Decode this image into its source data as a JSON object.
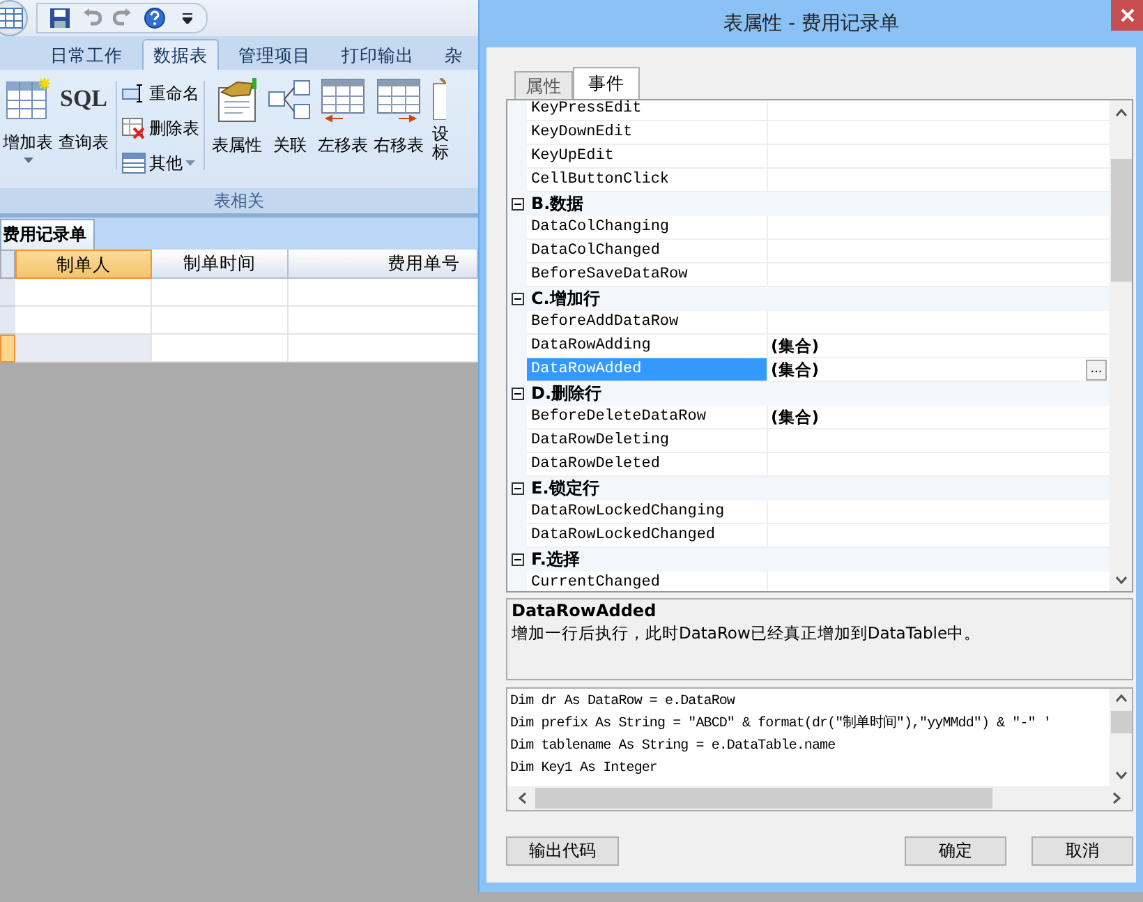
{
  "app": {
    "quick_access": [
      {
        "kind": "save"
      },
      {
        "kind": "undo"
      },
      {
        "kind": "redo"
      },
      {
        "kind": "help"
      },
      {
        "kind": "more"
      }
    ],
    "tabs": [
      {
        "label": "日常工作",
        "selected": false
      },
      {
        "label": "数据表",
        "selected": true
      },
      {
        "label": "管理项目",
        "selected": false
      },
      {
        "label": "打印输出",
        "selected": false
      },
      {
        "label": "杂",
        "selected": false
      }
    ],
    "ribbon": {
      "group": "表相关",
      "large_left": [
        {
          "kind": "add-table",
          "label": "增加表",
          "dropdown": true
        },
        {
          "kind": "sql",
          "icon_text": "SQL",
          "label": "查询表"
        }
      ],
      "small": [
        {
          "kind": "rename",
          "label": "重命名"
        },
        {
          "kind": "delete",
          "label": "删除表"
        },
        {
          "kind": "other",
          "label": "其他",
          "dropdown": true
        }
      ],
      "large_right": [
        {
          "kind": "props",
          "label": "表属性"
        },
        {
          "kind": "relate",
          "label": "关联"
        },
        {
          "kind": "move-left",
          "label": "左移表"
        },
        {
          "kind": "move-right",
          "label": "右移表"
        },
        {
          "kind": "cut",
          "label": "设标"
        }
      ]
    },
    "sheet_tab": "费用记录单",
    "table": {
      "columns": [
        {
          "label": "制单人",
          "selected": true
        },
        {
          "label": "制单时间",
          "selected": false
        },
        {
          "label": "费用单号",
          "selected": false
        }
      ],
      "rows": [
        {
          "selected": false
        },
        {
          "selected": false
        },
        {
          "selected": true
        }
      ]
    }
  },
  "dialog": {
    "title": "表属性 - 费用记录单",
    "tabs": [
      {
        "label": "属性",
        "selected": false
      },
      {
        "label": "事件",
        "selected": true
      }
    ],
    "sections": [
      {
        "items": [
          {
            "name": "KeyPressEdit",
            "selected": false
          },
          {
            "name": "KeyDownEdit",
            "selected": false
          },
          {
            "name": "KeyUpEdit",
            "selected": false
          },
          {
            "name": "CellButtonClick",
            "selected": false
          }
        ]
      },
      {
        "title": "B.数据",
        "expanded": true,
        "items": [
          {
            "name": "DataColChanging",
            "selected": false
          },
          {
            "name": "DataColChanged",
            "selected": false
          },
          {
            "name": "BeforeSaveDataRow",
            "selected": false
          }
        ]
      },
      {
        "title": "C.增加行",
        "expanded": true,
        "items": [
          {
            "name": "BeforeAddDataRow",
            "selected": false
          },
          {
            "name": "DataRowAdding",
            "value": "(集合)",
            "selected": false
          },
          {
            "name": "DataRowAdded",
            "value": "(集合)",
            "button": "...",
            "selected": true
          }
        ]
      },
      {
        "title": "D.删除行",
        "expanded": true,
        "items": [
          {
            "name": "BeforeDeleteDataRow",
            "value": "(集合)",
            "selected": false
          },
          {
            "name": "DataRowDeleting",
            "selected": false
          },
          {
            "name": "DataRowDeleted",
            "selected": false
          }
        ]
      },
      {
        "title": "E.锁定行",
        "expanded": true,
        "items": [
          {
            "name": "DataRowLockedChanging",
            "selected": false
          },
          {
            "name": "DataRowLockedChanged",
            "selected": false
          }
        ]
      },
      {
        "title": "F.选择",
        "expanded": true,
        "items": [
          {
            "name": "CurrentChanged",
            "selected": false
          }
        ]
      }
    ],
    "description": {
      "title": "DataRowAdded",
      "text": "增加一行后执行，此时DataRow已经真正增加到DataTable中。"
    },
    "code": [
      "Dim dr As DataRow = e.DataRow",
      "Dim prefix As String = \"ABCD\" & format(dr(\"制单时间\"),\"yyMMdd\") & \"-\" '",
      "Dim tablename As String = e.DataTable.name",
      "Dim Key1 As Integer"
    ],
    "buttons": {
      "left": [
        "输出代码"
      ],
      "right": [
        "确定",
        "取消"
      ]
    }
  }
}
